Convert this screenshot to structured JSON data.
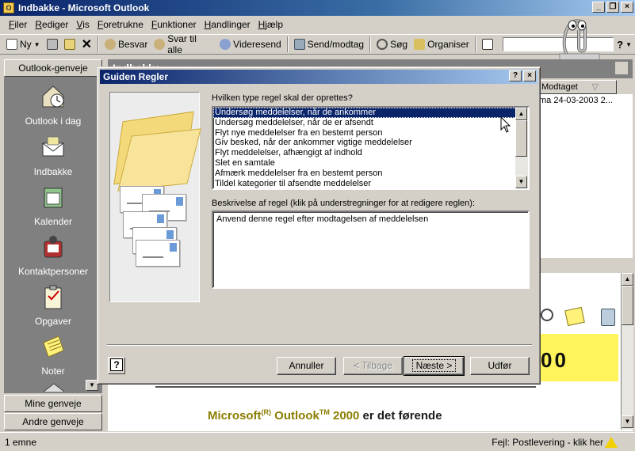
{
  "window": {
    "title": "Indbakke - Microsoft Outlook",
    "controls": [
      "_",
      "❐",
      "×"
    ]
  },
  "menu": [
    "Filer",
    "Rediger",
    "Vis",
    "Foretrukne",
    "Funktioner",
    "Handlinger",
    "Hjælp"
  ],
  "toolbar": {
    "new_label": "Ny",
    "reply": "Besvar",
    "reply_all": "Svar til alle",
    "forward": "Videresend",
    "send_receive": "Send/modtag",
    "find": "Søg",
    "organize": "Organiser"
  },
  "outlook_bar": {
    "header": "Outlook-genveje",
    "items": [
      {
        "label": "Outlook i dag",
        "icon": "outlook-today-icon"
      },
      {
        "label": "Indbakke",
        "icon": "inbox-icon"
      },
      {
        "label": "Kalender",
        "icon": "calendar-icon"
      },
      {
        "label": "Kontaktpersoner",
        "icon": "contacts-icon"
      },
      {
        "label": "Opgaver",
        "icon": "tasks-icon"
      },
      {
        "label": "Noter",
        "icon": "notes-icon"
      }
    ],
    "groups": [
      "Mine genveje",
      "Andre genveje"
    ]
  },
  "inbox": {
    "header": "Indbakke",
    "column_received": "Modtaget",
    "row_received": "ma 24-03-2003 2..."
  },
  "preview": {
    "yellow_text": "00",
    "promo_pre": "Microsoft",
    "promo_sup1": "(R)",
    "promo_mid": " Outlook",
    "promo_sup2": "TM",
    "promo_year": " 2000",
    "promo_post": " er det førende"
  },
  "dialog": {
    "title": "Guiden Regler",
    "question": "Hvilken type regel skal der oprettes?",
    "rules": [
      "Undersøg meddelelser, når de ankommer",
      "Undersøg meddelelser, når de er afsendt",
      "Flyt nye meddelelser fra en bestemt person",
      "Giv besked, når der ankommer vigtige meddelelser",
      "Flyt meddelelser, afhængigt af indhold",
      "Slet en samtale",
      "Afmærk meddelelser fra en bestemt person",
      "Tildel kategorier til afsendte meddelelser"
    ],
    "selected_index": 0,
    "description_label": "Beskrivelse af regel (klik på understregninger for at redigere reglen):",
    "description_text": "Anvend denne regel efter modtagelsen af meddelelsen",
    "buttons": {
      "cancel": "Annuller",
      "back": "< Tilbage",
      "next": "Næste >",
      "finish": "Udfør"
    }
  },
  "status": {
    "left": "1 emne",
    "right": "Fejl: Postlevering - klik her"
  }
}
